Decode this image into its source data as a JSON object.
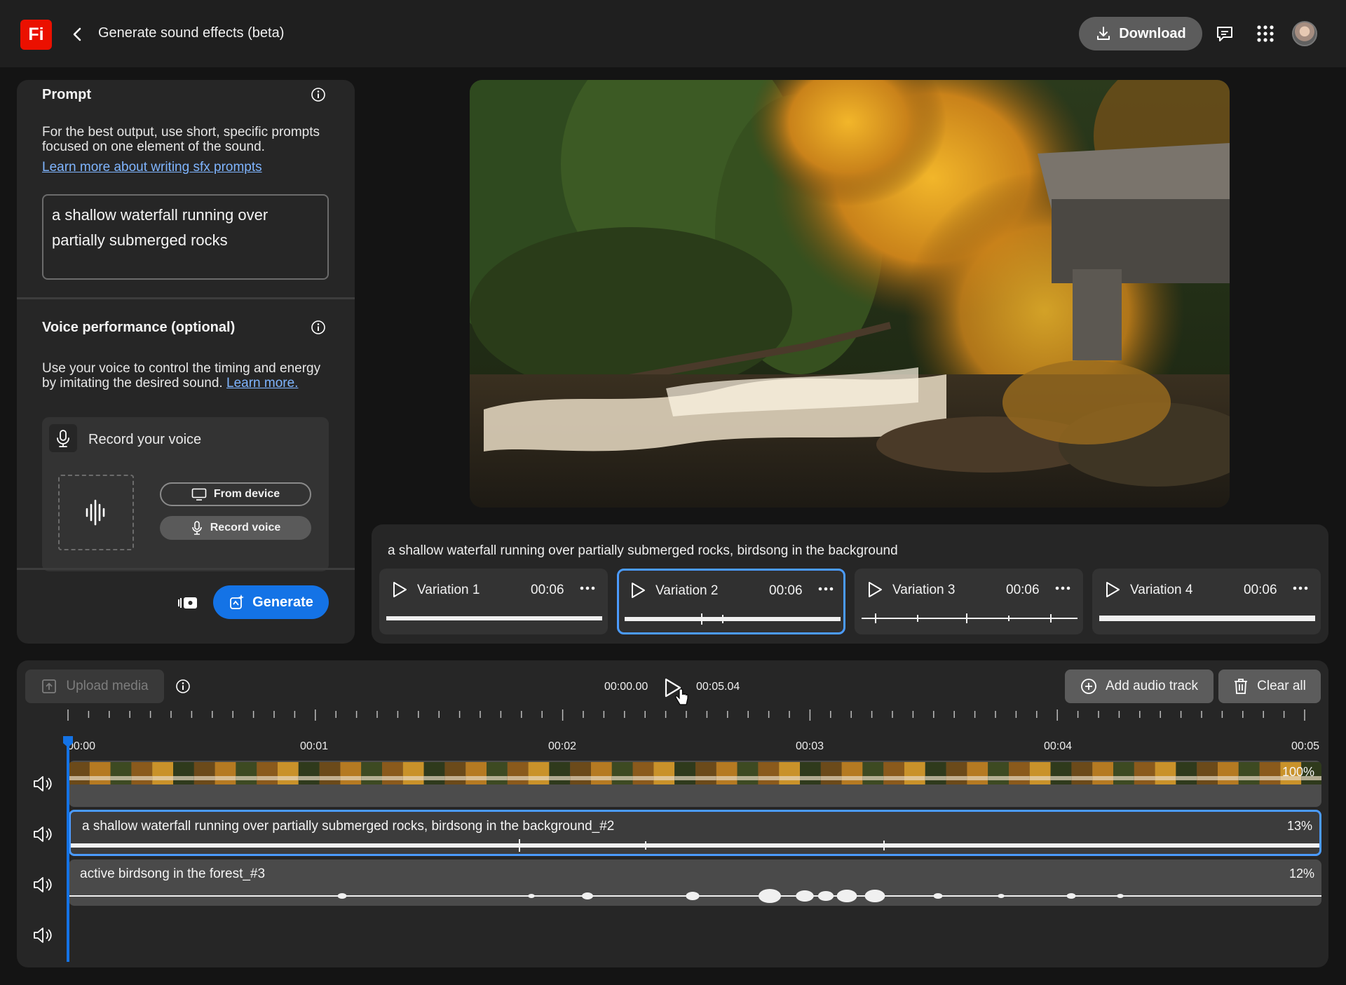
{
  "app": {
    "logo_text": "Fi",
    "title": "Generate sound effects (beta)",
    "download_label": "Download",
    "accent_color": "#1473e6",
    "brand_color": "#eb1000"
  },
  "prompt_section": {
    "title": "Prompt",
    "description": "For the best output, use short, specific prompts focused on one element of the sound.",
    "link": "Learn more about writing sfx prompts",
    "value": "a shallow waterfall running over partially submerged rocks"
  },
  "voice_section": {
    "title": "Voice performance (optional)",
    "description": "Use your voice to control the timing and energy by imitating the desired sound.",
    "link": "Learn more.",
    "record_label": "Record your voice",
    "from_device_label": "From device",
    "record_voice_label": "Record voice"
  },
  "generate_label": "Generate",
  "variations": {
    "caption": "a shallow waterfall running over partially submerged rocks, birdsong in the background",
    "items": [
      {
        "name": "Variation 1",
        "duration": "00:06",
        "selected": false
      },
      {
        "name": "Variation 2",
        "duration": "00:06",
        "selected": true
      },
      {
        "name": "Variation 3",
        "duration": "00:06",
        "selected": false
      },
      {
        "name": "Variation 4",
        "duration": "00:06",
        "selected": false
      }
    ]
  },
  "timeline": {
    "upload_label": "Upload media",
    "current_time": "00:00.00",
    "total_time": "00:05.04",
    "add_track_label": "Add audio track",
    "clear_label": "Clear all",
    "ticks": [
      "00:00",
      "00:01",
      "00:02",
      "00:03",
      "00:04",
      "00:05"
    ],
    "tracks": [
      {
        "label": "",
        "volume": "100%"
      },
      {
        "label": "a shallow waterfall running over partially submerged rocks, birdsong in the background_#2",
        "volume": "13%"
      },
      {
        "label": "active birdsong in the forest_#3",
        "volume": "12%"
      }
    ]
  }
}
